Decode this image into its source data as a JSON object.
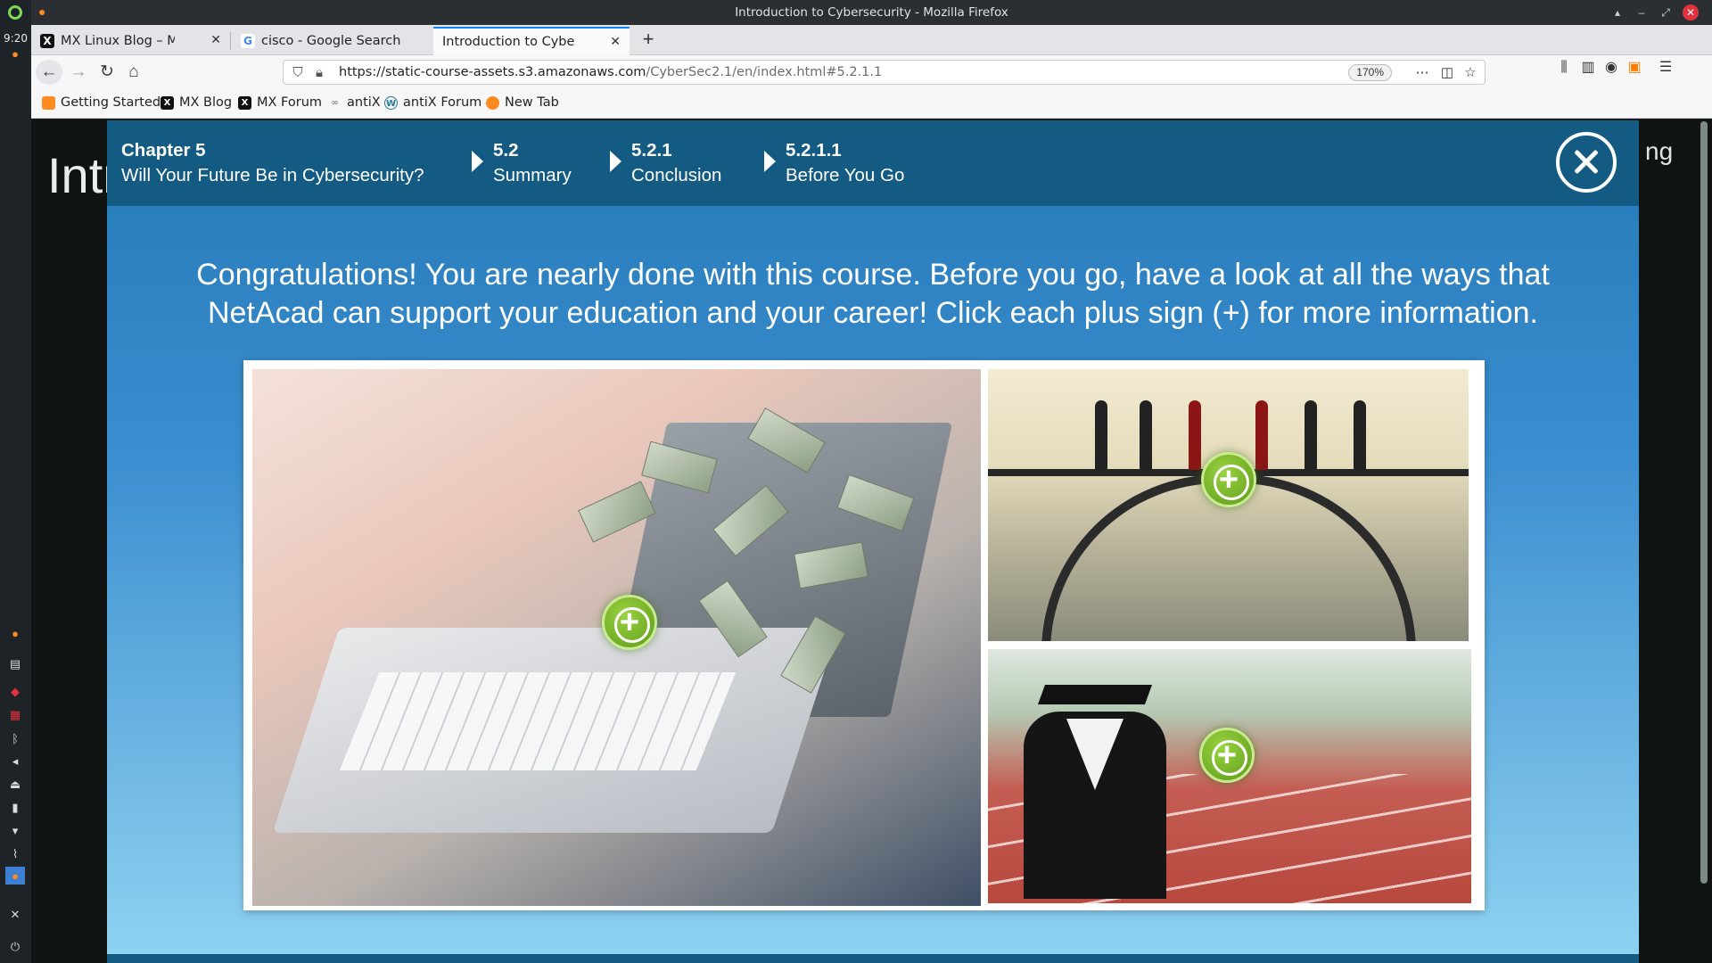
{
  "desktop": {
    "clock": "9:20"
  },
  "window": {
    "title": "Introduction to Cybersecurity - Mozilla Firefox"
  },
  "tabs": [
    {
      "label": "MX Linux Blog – MX Linux",
      "active": false
    },
    {
      "label": "cisco - Google Search",
      "active": false
    },
    {
      "label": "Introduction to Cybersecurity",
      "active": true
    }
  ],
  "navbar": {
    "url_host": "https://static-course-assets.s3.amazonaws.com",
    "url_path": "/CyberSec2.1/en/index.html#5.2.1.1",
    "zoom": "170%"
  },
  "bookmarks": [
    {
      "label": "Getting Started"
    },
    {
      "label": "MX Blog"
    },
    {
      "label": "MX Forum"
    },
    {
      "label": "antiX"
    },
    {
      "label": "antiX Forum"
    },
    {
      "label": "New Tab"
    }
  ],
  "page": {
    "bg_title": "Intr",
    "bg_title_right": "ng"
  },
  "modal": {
    "breadcrumbs": [
      {
        "num": "Chapter 5",
        "title": "Will Your Future Be in Cybersecurity?"
      },
      {
        "num": "5.2",
        "title": "Summary"
      },
      {
        "num": "5.2.1",
        "title": "Conclusion"
      },
      {
        "num": "5.2.1.1",
        "title": "Before You Go"
      }
    ],
    "intro": "Congratulations! You are nearly done with this course. Before you go, have a look at all the ways that NetAcad can support your education and your career! Click each plus sign (+) for more information."
  },
  "colors": {
    "modal_header": "#135b82",
    "plus_button": "#6fb12a",
    "tab_accent": "#0a84ff"
  }
}
